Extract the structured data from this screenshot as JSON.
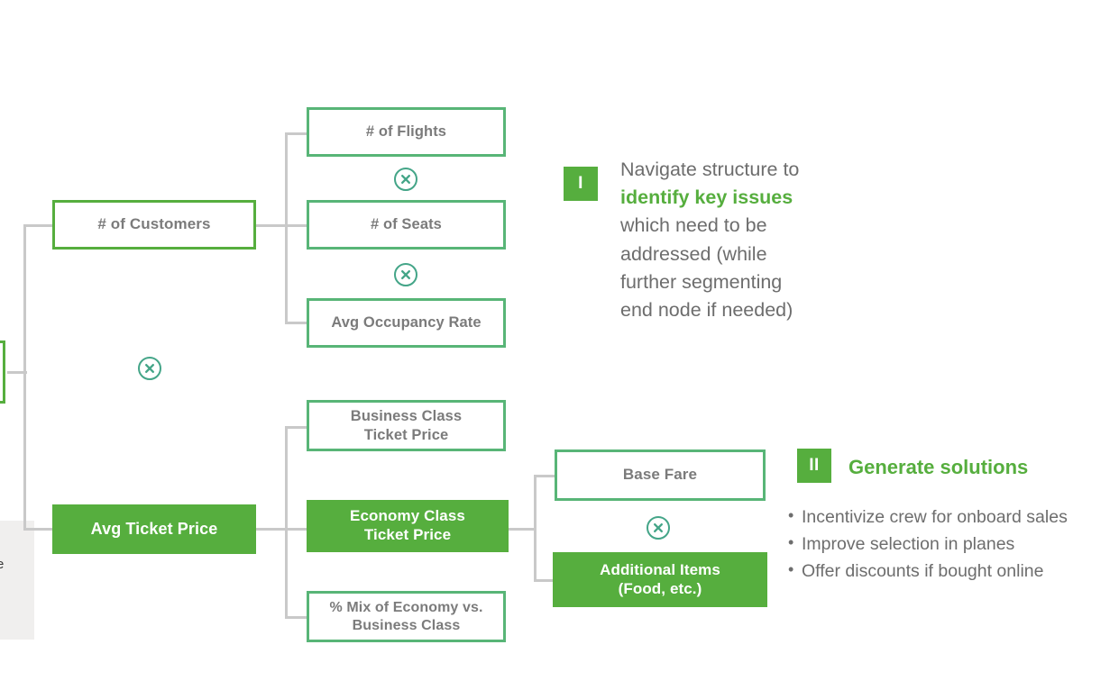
{
  "diagram": {
    "type": "issue-tree",
    "nodes": [
      {
        "id": "root_partial",
        "label": "",
        "style": "outline-accent"
      },
      {
        "id": "num_customers",
        "label": "# of Customers",
        "style": "outline-accent"
      },
      {
        "id": "avg_ticket_price",
        "label": "Avg Ticket Price",
        "style": "filled"
      },
      {
        "id": "num_flights",
        "label": "# of Flights",
        "style": "outline"
      },
      {
        "id": "num_seats",
        "label": "# of Seats",
        "style": "outline"
      },
      {
        "id": "avg_occupancy_rate",
        "label": "Avg Occupancy Rate",
        "style": "outline"
      },
      {
        "id": "business_class",
        "label": "Business Class\nTicket Price",
        "style": "outline"
      },
      {
        "id": "economy_class",
        "label": "Economy Class\nTicket Price",
        "style": "filled"
      },
      {
        "id": "pct_mix",
        "label": "% Mix of Economy vs.\nBusiness Class",
        "style": "outline"
      },
      {
        "id": "base_fare",
        "label": "Base Fare",
        "style": "outline"
      },
      {
        "id": "additional_items",
        "label": "Additional Items\n(Food, etc.)",
        "style": "filled"
      }
    ],
    "operators": [
      {
        "id": "op_1",
        "symbol": "×",
        "between": [
          "num_flights",
          "num_seats"
        ]
      },
      {
        "id": "op_2",
        "symbol": "×",
        "between": [
          "num_seats",
          "avg_occupancy_rate"
        ]
      },
      {
        "id": "op_3",
        "symbol": "×",
        "between": [
          "num_customers",
          "avg_ticket_price"
        ]
      },
      {
        "id": "op_4",
        "symbol": "×",
        "between": [
          "base_fare",
          "additional_items"
        ]
      }
    ],
    "node_labels": {
      "num_customers": "# of Customers",
      "avg_ticket_price": "Avg Ticket Price",
      "num_flights": "# of Flights",
      "num_seats": "# of Seats",
      "avg_occupancy_rate": "Avg Occupancy Rate",
      "business_class_line1": "Business Class",
      "business_class_line2": "Ticket Price",
      "economy_class_line1": "Economy Class",
      "economy_class_line2": "Ticket Price",
      "pct_mix_line1": "% Mix of Economy vs.",
      "pct_mix_line2": "Business Class",
      "base_fare": "Base Fare",
      "additional_items_line1": "Additional Items",
      "additional_items_line2": "(Food, etc.)"
    }
  },
  "annotations": {
    "step_one": {
      "marker": "I",
      "text_before": "Navigate structure to",
      "highlight": "identify key issues",
      "text_after_line1": "which need to be",
      "text_after_line2": "addressed (while",
      "text_after_line3": "further segmenting",
      "text_after_line4": "end node if needed)"
    },
    "step_two": {
      "marker": "II",
      "title": "Generate solutions",
      "bullets": [
        "Incentivize crew for onboard sales",
        "Improve selection in planes",
        "Offer discounts if bought online"
      ]
    }
  },
  "side_panel": {
    "clipped_glyph": "e"
  },
  "colors": {
    "accent_green": "#56ae3e",
    "soft_green": "#58b577",
    "operator_teal": "#44a588",
    "connector_gray": "#c9c9c9",
    "text_gray": "#7b7b7b",
    "annotation_gray": "#6d6d6d",
    "panel_gray": "#f0efee",
    "background": "#ffffff"
  }
}
